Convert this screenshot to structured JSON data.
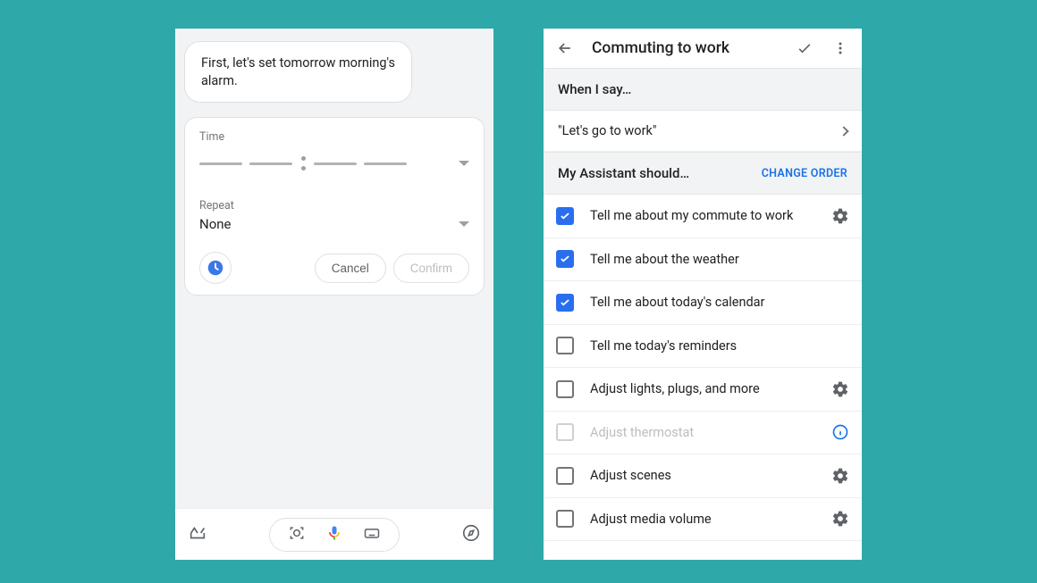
{
  "left": {
    "bubble": "First, let's set tomorrow morning's alarm.",
    "time_label": "Time",
    "repeat_label": "Repeat",
    "repeat_value": "None",
    "cancel": "Cancel",
    "confirm": "Confirm"
  },
  "right": {
    "title": "Commuting to work",
    "when_i_say": "When I say…",
    "phrase": "\"Let's go to work\"",
    "assistant_should": "My Assistant should…",
    "change_order": "CHANGE ORDER",
    "actions": [
      {
        "label": "Tell me about my commute to work",
        "checked": true,
        "trail": "gear"
      },
      {
        "label": "Tell me about the weather",
        "checked": true,
        "trail": "none"
      },
      {
        "label": "Tell me about today's calendar",
        "checked": true,
        "trail": "none"
      },
      {
        "label": "Tell me today's reminders",
        "checked": false,
        "trail": "none"
      },
      {
        "label": "Adjust lights, plugs, and more",
        "checked": false,
        "trail": "gear"
      },
      {
        "label": "Adjust thermostat",
        "checked": false,
        "trail": "info",
        "disabled": true
      },
      {
        "label": "Adjust scenes",
        "checked": false,
        "trail": "gear"
      },
      {
        "label": "Adjust media volume",
        "checked": false,
        "trail": "gear"
      }
    ]
  }
}
